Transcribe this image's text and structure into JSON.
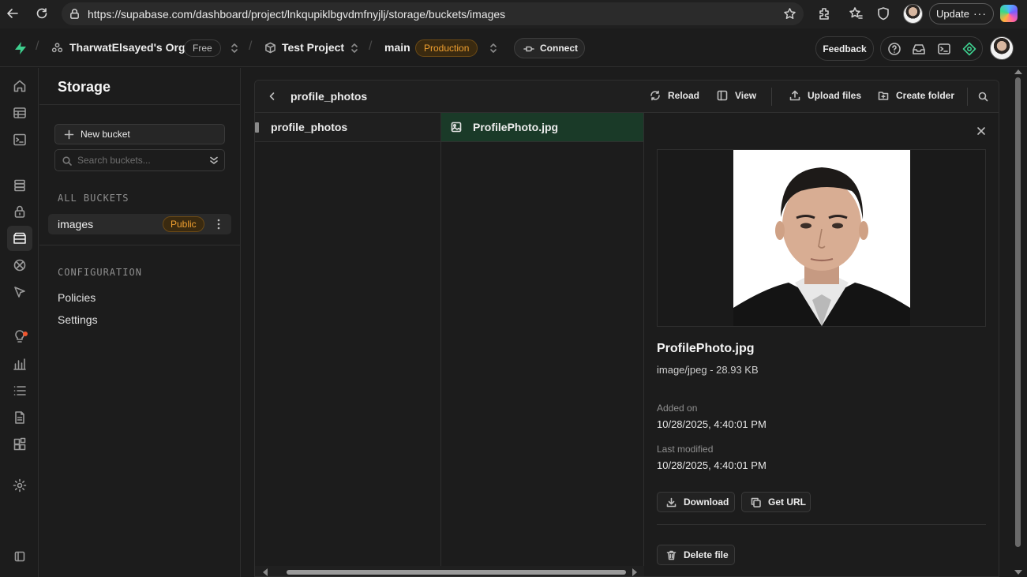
{
  "browser": {
    "url": "https://supabase.com/dashboard/project/lnkqupiklbgvdmfnyjlj/storage/buckets/images",
    "update_label": "Update"
  },
  "header": {
    "org_name": "TharwatElsayed's Org",
    "org_plan": "Free",
    "project_name": "Test Project",
    "branch_name": "main",
    "branch_badge": "Production",
    "connect_label": "Connect",
    "feedback_label": "Feedback"
  },
  "sidebar": {
    "title": "Storage",
    "new_bucket_label": "New bucket",
    "search_placeholder": "Search buckets...",
    "all_buckets_label": "ALL BUCKETS",
    "buckets": [
      {
        "name": "images",
        "badge": "Public"
      }
    ],
    "configuration_label": "CONFIGURATION",
    "configuration_items": [
      "Policies",
      "Settings"
    ]
  },
  "explorer": {
    "path": "profile_photos",
    "actions": {
      "reload": "Reload",
      "view": "View",
      "upload": "Upload files",
      "create_folder": "Create folder"
    },
    "folder_column": [
      "profile_photos"
    ],
    "file_column": [
      "ProfilePhoto.jpg"
    ]
  },
  "preview": {
    "file_name": "ProfilePhoto.jpg",
    "file_meta": "image/jpeg - 28.93 KB",
    "added_label": "Added on",
    "added_value": "10/28/2025, 4:40:01 PM",
    "modified_label": "Last modified",
    "modified_value": "10/28/2025, 4:40:01 PM",
    "download_label": "Download",
    "get_url_label": "Get URL",
    "delete_label": "Delete file"
  },
  "colors": {
    "brand": "#3ecf8e",
    "selected_row": "#1a3a28",
    "badge_orange": "#f0a030",
    "background": "#1c1c1c"
  }
}
